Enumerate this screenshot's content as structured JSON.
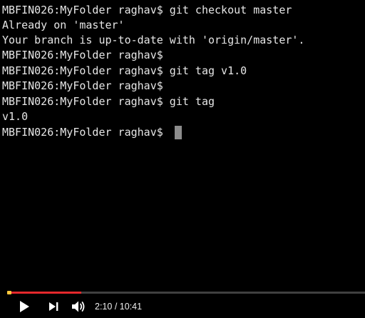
{
  "terminal": {
    "lines": [
      "MBFIN026:MyFolder raghav$ git checkout master",
      "Already on 'master'",
      "Your branch is up-to-date with 'origin/master'.",
      "MBFIN026:MyFolder raghav$",
      "MBFIN026:MyFolder raghav$ git tag v1.0",
      "MBFIN026:MyFolder raghav$",
      "MBFIN026:MyFolder raghav$ git tag",
      "v1.0",
      "MBFIN026:MyFolder raghav$"
    ],
    "text_color": "#e6e6e6",
    "background": "#000000"
  },
  "player": {
    "current_time": "2:10",
    "separator": "/",
    "duration": "10:41",
    "progress_fraction": 0.203,
    "progress_color": "#e5282c",
    "icons": {
      "play": "play-icon",
      "next": "next-icon",
      "volume": "volume-icon"
    }
  }
}
